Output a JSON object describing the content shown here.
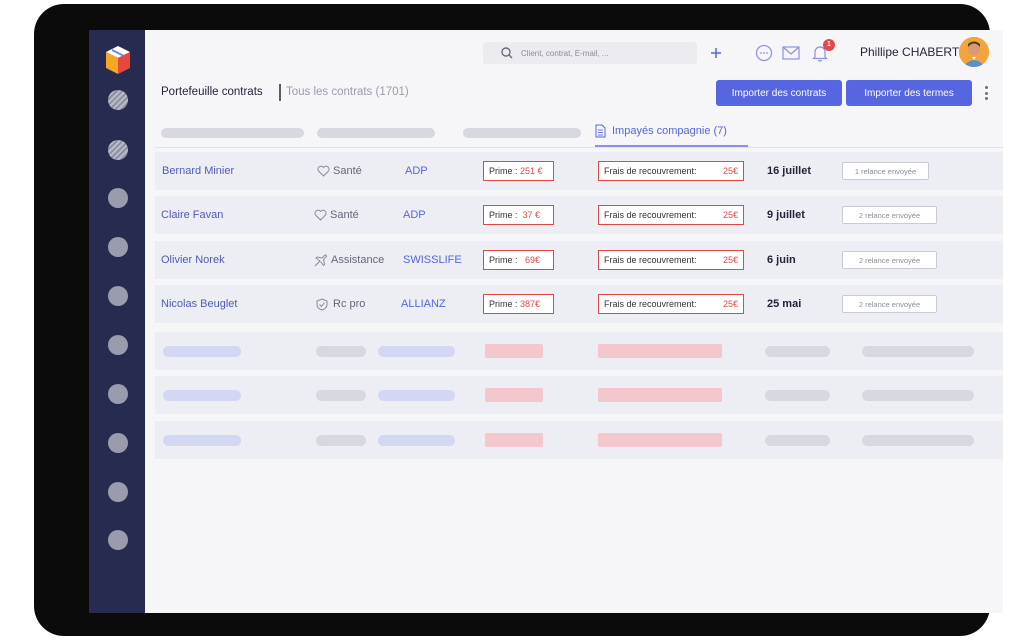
{
  "search": {
    "placeholder": "Client, contrat, E-mail, ..."
  },
  "notifications": {
    "count": "1"
  },
  "user": {
    "name": "Phillipe CHABERT"
  },
  "header": {
    "title": "Portefeuille contrats",
    "subtitle": "Tous les contrats (1701)",
    "import_contracts": "Importer des contrats",
    "import_terms": "Importer des termes"
  },
  "tabs": {
    "active_label": "Impayés compagnie (7)"
  },
  "rows": [
    {
      "name": "Bernard Minier",
      "type": "Santé",
      "type_icon": "heart-icon",
      "company": "ADP",
      "prime_label": "Prime :",
      "prime_value": "251 €",
      "frais_label": "Frais de recouvrement:",
      "frais_value": "25€",
      "date": "16 juillet",
      "relance": "1 relance envoyée"
    },
    {
      "name": "Claire Favan",
      "type": "Santé",
      "type_icon": "heart-icon",
      "company": "ADP",
      "prime_label": "Prime :",
      "prime_value": "37 €",
      "frais_label": "Frais de recouvrement:",
      "frais_value": "25€",
      "date": "9 juillet",
      "relance": "2 relance envoyée"
    },
    {
      "name": "Olivier Norek",
      "type": "Assistance",
      "type_icon": "airplane-icon",
      "company": "SWISSLIFE",
      "prime_label": "Prime :",
      "prime_value": "69€",
      "frais_label": "Frais de recouvrement:",
      "frais_value": "25€",
      "date": "6 juin",
      "relance": "2 relance envoyée"
    },
    {
      "name": "Nicolas Beuglet",
      "type": "Rc pro",
      "type_icon": "shield-icon",
      "company": "ALLIANZ",
      "prime_label": "Prime :",
      "prime_value": "387€",
      "frais_label": "Frais de recouvrement:",
      "frais_value": "25€",
      "date": "25 mai",
      "relance": "2 relance envoyée"
    }
  ],
  "colors": {
    "sidebar": "#262b4f",
    "accent": "#5566e0",
    "alert": "#e04848"
  }
}
